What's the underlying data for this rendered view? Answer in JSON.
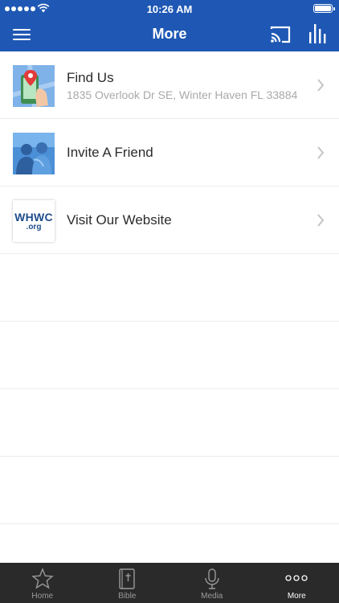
{
  "status_bar": {
    "time": "10:26 AM"
  },
  "nav": {
    "title": "More"
  },
  "items": [
    {
      "title": "Find Us",
      "subtitle": "1835 Overlook Dr SE, Winter Haven FL 33884"
    },
    {
      "title": "Invite A Friend",
      "subtitle": ""
    },
    {
      "title": "Visit Our Website",
      "subtitle": ""
    }
  ],
  "website_logo": {
    "line1": "WHWC",
    "line2": ".org"
  },
  "tabs": [
    {
      "label": "Home",
      "icon": "star-icon"
    },
    {
      "label": "Bible",
      "icon": "bible-icon"
    },
    {
      "label": "Media",
      "icon": "microphone-icon"
    },
    {
      "label": "More",
      "icon": "more-dots-icon"
    }
  ],
  "colors": {
    "header": "#1f58b4",
    "tabbar": "#2a2a2a",
    "tab_inactive": "#9a9a9a",
    "tab_active": "#ffffff"
  }
}
